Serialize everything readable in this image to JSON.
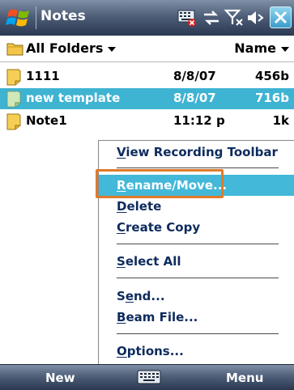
{
  "titlebar": {
    "title": "Notes"
  },
  "header": {
    "folder_label": "All Folders",
    "sort_label": "Name"
  },
  "files": [
    {
      "name": "1111",
      "date": "8/8/07",
      "size": "456b",
      "icon": "note-icon"
    },
    {
      "name": "new template",
      "date": "8/8/07",
      "size": "716b",
      "icon": "template-icon"
    },
    {
      "name": "Note1",
      "date": "11:12 p",
      "size": "1k",
      "icon": "note-icon"
    }
  ],
  "menu": {
    "items": [
      {
        "label": "View Recording Toolbar",
        "u": "V"
      },
      {
        "label": "Rename/Move...",
        "u": "R"
      },
      {
        "label": "Delete",
        "u": "D"
      },
      {
        "label": "Create Copy",
        "u": "C"
      },
      {
        "label": "Select All",
        "u": "S"
      },
      {
        "label": "Send...",
        "u": "e"
      },
      {
        "label": "Beam File...",
        "u": "B"
      },
      {
        "label": "Options...",
        "u": "O"
      }
    ]
  },
  "softkeys": {
    "left": "New",
    "right": "Menu"
  },
  "colors": {
    "selection": "#3fb3d2",
    "focus_outline": "#e07a28",
    "menu_text": "#0e2b5d"
  }
}
